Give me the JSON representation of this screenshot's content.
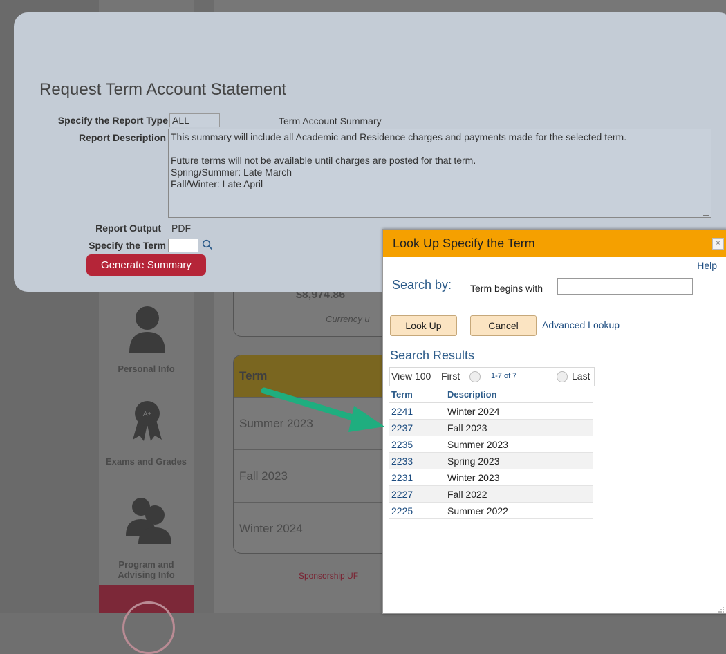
{
  "background": {
    "balance_amount": "$8,974.86",
    "currency_note": "Currency u",
    "term_table": {
      "header": "Term",
      "rows": [
        "Summer 2023",
        "Fall 2023",
        "Winter 2024"
      ]
    },
    "sidebar": [
      {
        "label": "Personal Info",
        "icon": "person-icon"
      },
      {
        "label": "Exams and Grades",
        "icon": "award-ribbon-icon"
      },
      {
        "label": "Program and Advising Info",
        "icon": "people-icon"
      }
    ],
    "footer_links": "Sponsorship   UF"
  },
  "request": {
    "title": "Request Term Account Statement",
    "report_type_label": "Specify the Report Type",
    "report_type_value": "ALL",
    "report_type_name": "Term Account Summary",
    "description_label": "Report Description",
    "description_lines": [
      "This summary will include all Academic and Residence charges and payments made for the selected term.",
      "",
      "Future terms will not be available until charges are posted for that term.",
      "Spring/Summer: Late March",
      "Fall/Winter: Late April"
    ],
    "output_label": "Report Output",
    "output_value": "PDF",
    "term_label": "Specify the Term",
    "term_value": "",
    "generate_button": "Generate Summary"
  },
  "lookup": {
    "title": "Look Up Specify the Term",
    "close_glyph": "×",
    "help": "Help",
    "search_by_label": "Search by:",
    "begins_label": "Term begins with",
    "begins_value": "",
    "lookup_button": "Look Up",
    "cancel_button": "Cancel",
    "advanced_link": "Advanced Lookup",
    "results_title": "Search Results",
    "nav": {
      "view": "View 100",
      "first": "First",
      "range": "1-7 of 7",
      "last": "Last"
    },
    "columns": [
      "Term",
      "Description"
    ],
    "rows": [
      {
        "term": "2241",
        "description": "Winter 2024"
      },
      {
        "term": "2237",
        "description": "Fall 2023"
      },
      {
        "term": "2235",
        "description": "Summer 2023"
      },
      {
        "term": "2233",
        "description": "Spring 2023"
      },
      {
        "term": "2231",
        "description": "Winter 2023"
      },
      {
        "term": "2227",
        "description": "Fall 2022"
      },
      {
        "term": "2225",
        "description": "Summer 2022"
      }
    ]
  },
  "colors": {
    "accent_orange": "#f5a000",
    "button_red": "#b52538",
    "arrow_teal": "#1fae7f",
    "link_blue": "#1c4c80"
  }
}
